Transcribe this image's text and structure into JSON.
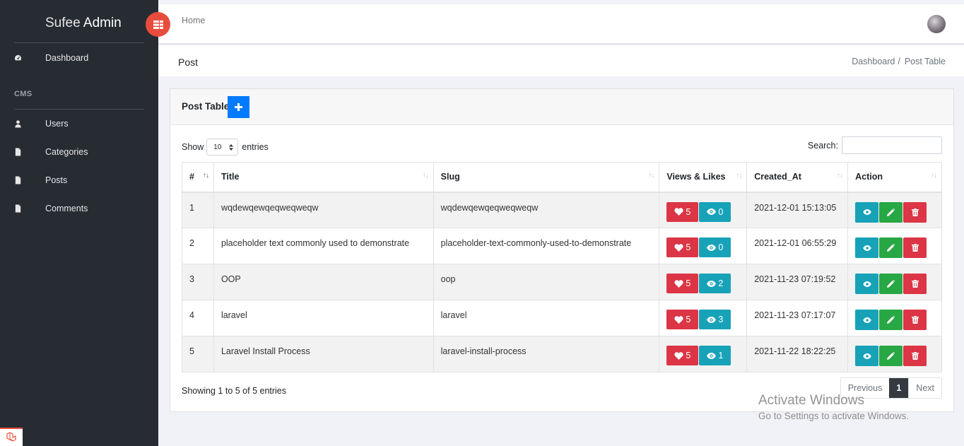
{
  "brand": {
    "light": "Sufee",
    "bold": "Admin"
  },
  "sidebar": {
    "dashboard": "Dashboard",
    "section": "CMS",
    "items": [
      {
        "label": "Users",
        "icon": "user-icon"
      },
      {
        "label": "Categories",
        "icon": "file-icon"
      },
      {
        "label": "Posts",
        "icon": "file-icon"
      },
      {
        "label": "Comments",
        "icon": "file-icon"
      }
    ]
  },
  "header": {
    "home": "Home"
  },
  "breadcrumb": {
    "page_title": "Post",
    "crumb1": "Dashboard",
    "separator": "/",
    "crumb2": "Post Table"
  },
  "card": {
    "title": "Post Table"
  },
  "controls": {
    "show": "Show",
    "length": "10",
    "entries": "entries",
    "search": "Search:"
  },
  "table": {
    "columns": [
      "#",
      "Title",
      "Slug",
      "Views & Likes",
      "Created_At",
      "Action"
    ],
    "rows": [
      {
        "id": "1",
        "title": "wqdewqewqeqweqweqw",
        "slug": "wqdewqewqeqweqweqw",
        "likes": "5",
        "views": "0",
        "created": "2021-12-01 15:13:05"
      },
      {
        "id": "2",
        "title": "placeholder text commonly used to demonstrate",
        "slug": "placeholder-text-commonly-used-to-demonstrate",
        "likes": "5",
        "views": "0",
        "created": "2021-12-01 06:55:29"
      },
      {
        "id": "3",
        "title": "OOP",
        "slug": "oop",
        "likes": "5",
        "views": "2",
        "created": "2021-11-23 07:19:52"
      },
      {
        "id": "4",
        "title": "laravel",
        "slug": "laravel",
        "likes": "5",
        "views": "3",
        "created": "2021-11-23 07:17:07"
      },
      {
        "id": "5",
        "title": "Laravel Install Process",
        "slug": "laravel-install-process",
        "likes": "5",
        "views": "1",
        "created": "2021-11-22 18:22:25"
      }
    ]
  },
  "footer": {
    "info": "Showing 1 to 5 of 5 entries",
    "previous": "Previous",
    "page": "1",
    "next": "Next"
  },
  "watermark": {
    "line1": "Activate Windows",
    "line2": "Go to Settings to activate Windows."
  },
  "colors": {
    "sidebar": "#272c33",
    "accent_red": "#dc3545",
    "accent_teal": "#17a2b8",
    "accent_green": "#28a745",
    "primary": "#007bff",
    "toggle": "#e74c3c"
  }
}
